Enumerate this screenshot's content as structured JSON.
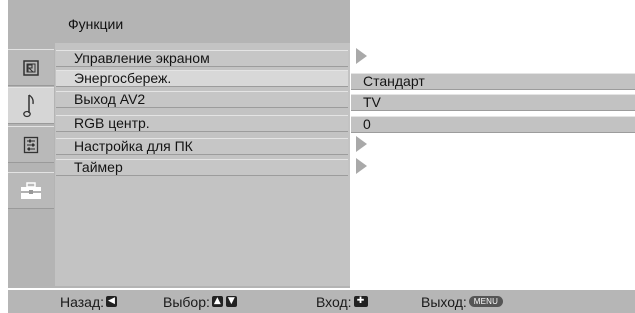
{
  "header": {
    "title": "Функции"
  },
  "sidebar": {
    "icons": [
      {
        "name": "picture-icon"
      },
      {
        "name": "sound-icon",
        "selected": true
      },
      {
        "name": "setup-icon"
      },
      {
        "name": "features-icon"
      }
    ]
  },
  "menu": {
    "items": [
      {
        "label": "Управление экраном",
        "has_submenu": true
      },
      {
        "label": "Энергосбереж.",
        "value": "Стандарт"
      },
      {
        "label": "Выход AV2",
        "value": "TV"
      },
      {
        "label": "RGB центр.",
        "value": "0"
      },
      {
        "label": "Настройка для ПК",
        "has_submenu": true
      },
      {
        "label": "Таймер",
        "has_submenu": true
      }
    ]
  },
  "footer": {
    "back_label": "Назад:",
    "select_label": "Выбор:",
    "enter_label": "Вход:",
    "exit_label": "Выход:",
    "menu_button": "MENU",
    "back_icon": "arrow-left-icon",
    "up_icon": "arrow-up-icon",
    "down_icon": "arrow-down-icon",
    "enter_icon": "enter-cross-icon"
  },
  "colors": {
    "panel": "#c3c3c3",
    "frame": "#b4b4b4",
    "highlight": "#d8d8d8",
    "text": "#141414"
  }
}
